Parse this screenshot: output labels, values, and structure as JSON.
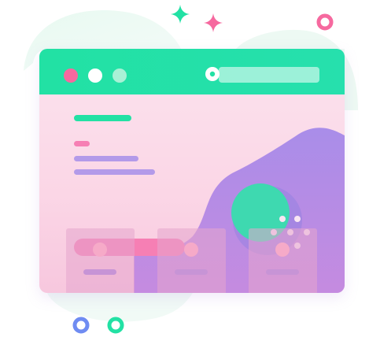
{
  "illustration": {
    "kind": "website-mockup-illustration",
    "colors": {
      "primary_green": "#22e1a4",
      "pink": "#f67fb4",
      "purple": "#a78ce8",
      "lilac_line": "#b9a0ef",
      "blue": "#6f8cf2",
      "light_green_dot": "#a9f1d6"
    },
    "window": {
      "buttons": [
        "pink-dot",
        "white-dot",
        "light-green-dot"
      ],
      "search": {
        "icon": "search-icon",
        "value": ""
      }
    },
    "hero": {
      "lines": [
        "green-heading-bar",
        "pink-tag-bar",
        "purple-text-bar",
        "purple-text-bar"
      ],
      "button": "pink-cta-button"
    },
    "cards": [
      {
        "icon": "avatar"
      },
      {
        "icon": "avatar"
      },
      {
        "icon": "avatar"
      }
    ]
  }
}
